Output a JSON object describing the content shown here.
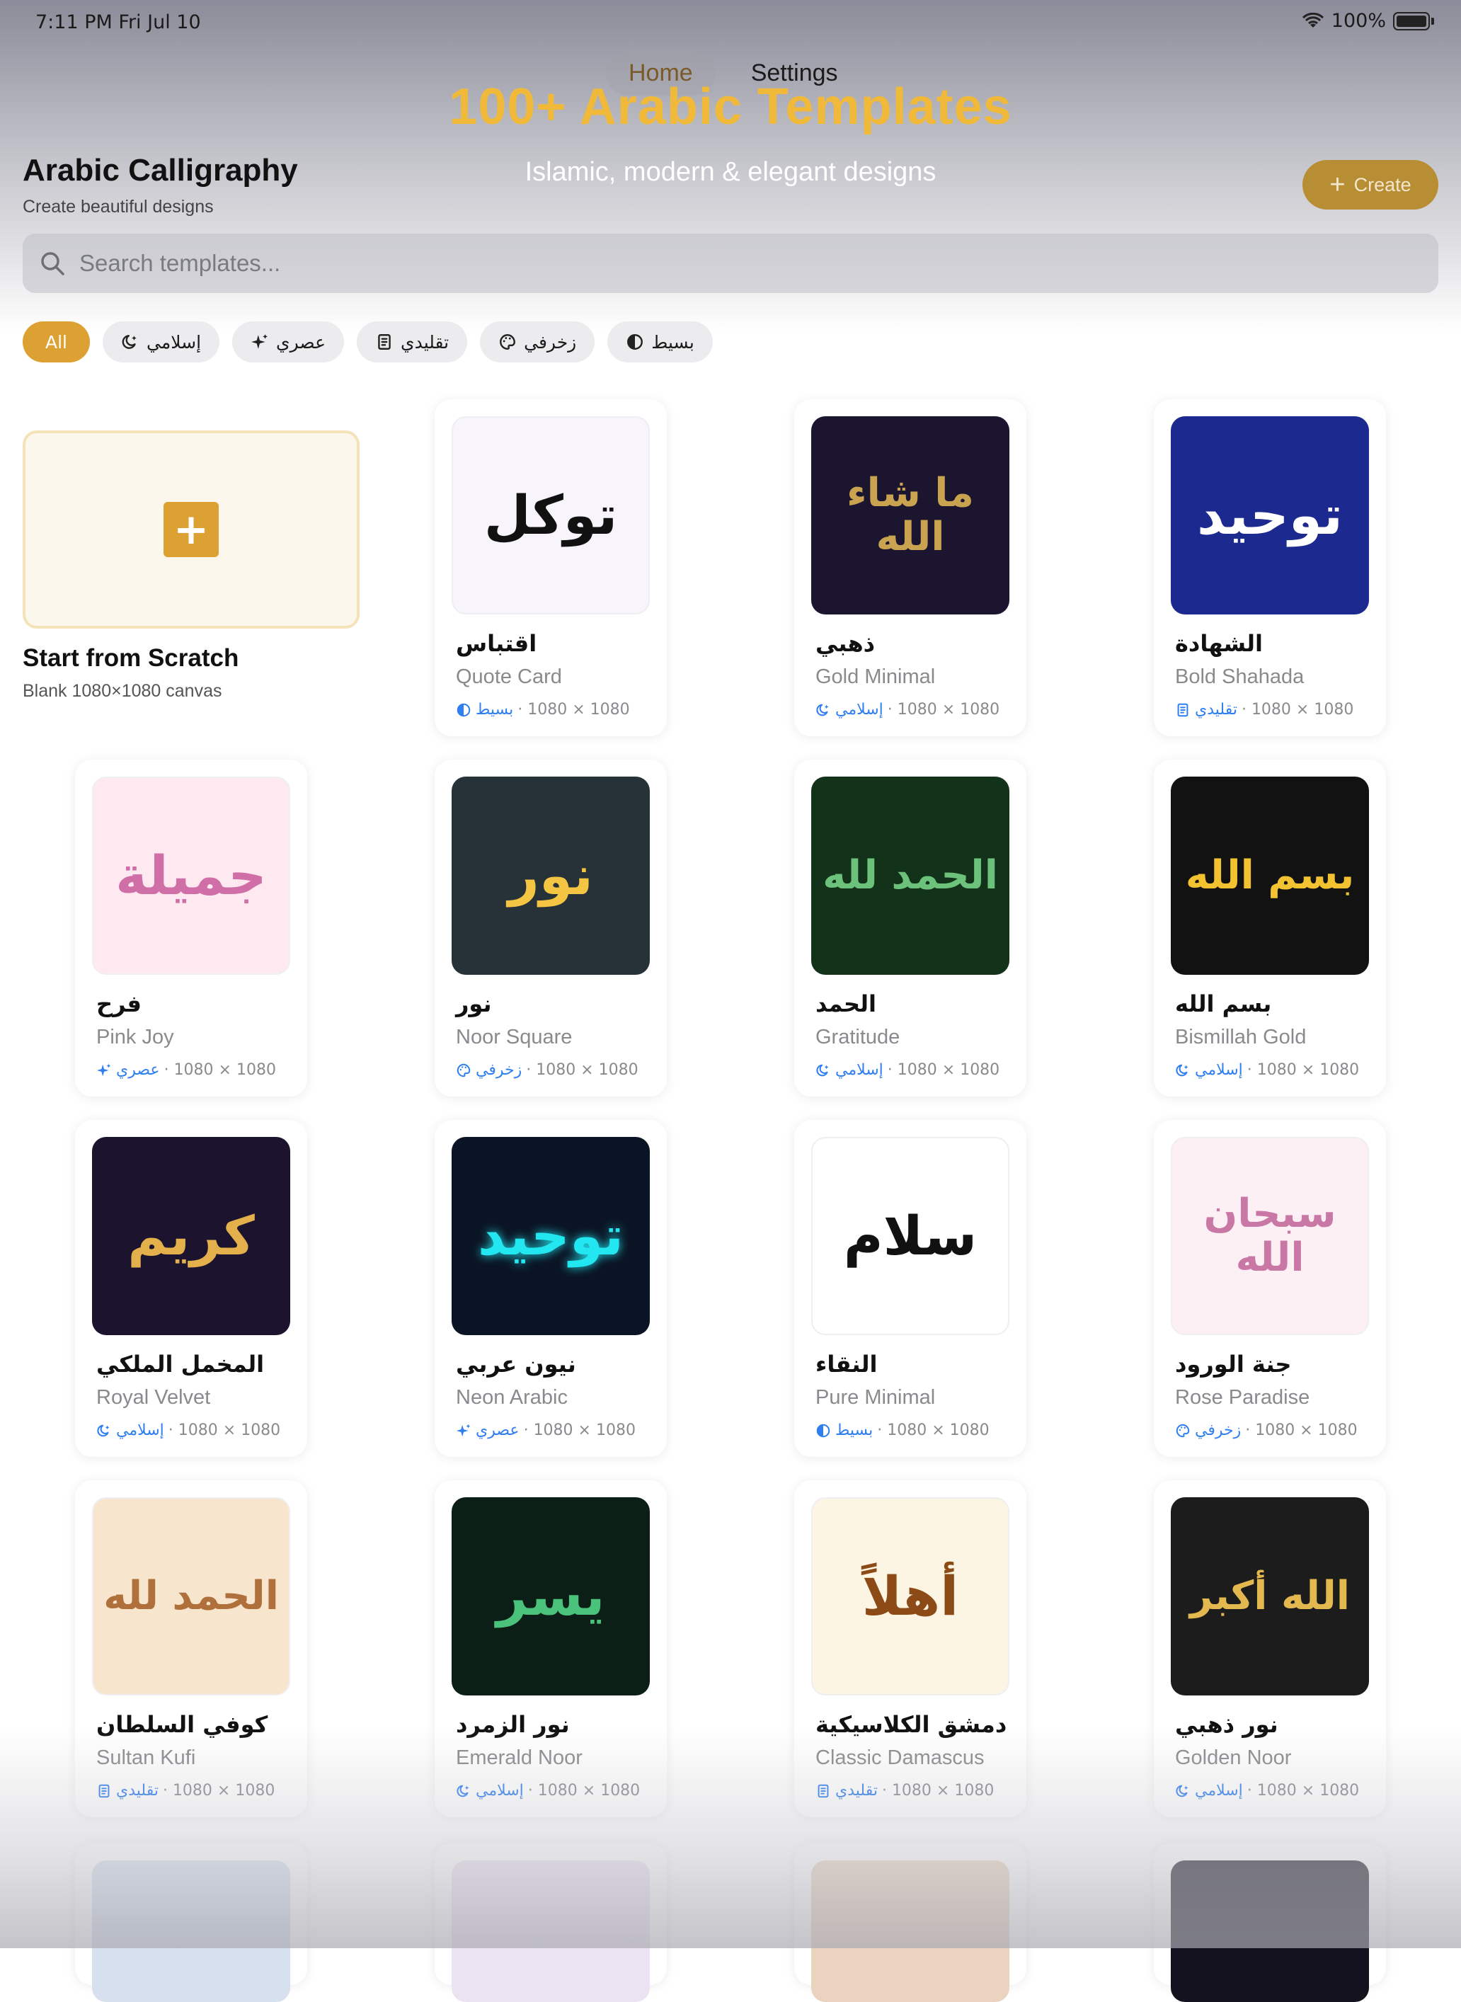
{
  "status": {
    "time": "7:11 PM   Fri Jul 10",
    "battery": "100%"
  },
  "tabs": [
    {
      "label": "Home"
    },
    {
      "label": "Settings"
    }
  ],
  "banner": {
    "title": "100+ Arabic Templates",
    "subtitle": "Islamic, modern & elegant designs"
  },
  "header": {
    "title": "Arabic Calligraphy",
    "subtitle": "Create beautiful designs",
    "create_label": "Create"
  },
  "search": {
    "placeholder": "Search templates..."
  },
  "filters": [
    {
      "label": "All",
      "icon": ""
    },
    {
      "label": "إسلامي",
      "icon": "moon-icon"
    },
    {
      "label": "عصري",
      "icon": "sparkle-icon"
    },
    {
      "label": "تقليدي",
      "icon": "scroll-icon"
    },
    {
      "label": "زخرفي",
      "icon": "palette-icon"
    },
    {
      "label": "بسيط",
      "icon": "contrast-icon"
    }
  ],
  "scratch": {
    "title": "Start from Scratch",
    "subtitle": "Blank 1080×1080 canvas"
  },
  "templates": [
    {
      "ar_title": "اقتباس",
      "name": "Quote Card",
      "category": "بسيط",
      "category_icon": "contrast-icon",
      "size": "· 1080 × 1080",
      "preview_text": "توكل",
      "bg": "#f7f4fc",
      "fg": "#111111"
    },
    {
      "ar_title": "ذهبي",
      "name": "Gold Minimal",
      "category": "إسلامي",
      "category_icon": "moon-icon",
      "size": "· 1080 × 1080",
      "preview_text": "ما شاء الله",
      "bg": "#1b1530",
      "fg": "#caa350"
    },
    {
      "ar_title": "الشهادة",
      "name": "Bold Shahada",
      "category": "تقليدي",
      "category_icon": "scroll-icon",
      "size": "· 1080 × 1080",
      "preview_text": "توحيد",
      "bg": "#1c2a8f",
      "fg": "#ffffff"
    },
    {
      "ar_title": "فرح",
      "name": "Pink Joy",
      "category": "عصري",
      "category_icon": "sparkle-icon",
      "size": "· 1080 × 1080",
      "preview_text": "جميلة",
      "bg": "#fde9ef",
      "fg": "#d06fa7"
    },
    {
      "ar_title": "نور",
      "name": "Noor Square",
      "category": "زخرفي",
      "category_icon": "palette-icon",
      "size": "· 1080 × 1080",
      "preview_text": "نور",
      "bg": "#263238",
      "fg": "#f4c542"
    },
    {
      "ar_title": "الحمد",
      "name": "Gratitude",
      "category": "إسلامي",
      "category_icon": "moon-icon",
      "size": "· 1080 × 1080",
      "preview_text": "الحمد لله",
      "bg": "#12321a",
      "fg": "#6cc27a"
    },
    {
      "ar_title": "بسم الله",
      "name": "Bismillah Gold",
      "category": "إسلامي",
      "category_icon": "moon-icon",
      "size": "· 1080 × 1080",
      "preview_text": "بسم الله",
      "bg": "#121212",
      "fg": "#f2c230"
    },
    {
      "ar_title": "المخمل الملكي",
      "name": "Royal Velvet",
      "category": "إسلامي",
      "category_icon": "moon-icon",
      "size": "· 1080 × 1080",
      "preview_text": "كريم",
      "bg": "#1c132e",
      "fg": "#e3b04b"
    },
    {
      "ar_title": "نيون عربي",
      "name": "Neon Arabic",
      "category": "عصري",
      "category_icon": "sparkle-icon",
      "size": "· 1080 × 1080",
      "preview_text": "توحيد",
      "bg": "#0b1424",
      "fg": "#22e6f0"
    },
    {
      "ar_title": "النقاء",
      "name": "Pure Minimal",
      "category": "بسيط",
      "category_icon": "contrast-icon",
      "size": "· 1080 × 1080",
      "preview_text": "سلام",
      "bg": "#ffffff",
      "fg": "#111111"
    },
    {
      "ar_title": "جنة الورود",
      "name": "Rose Paradise",
      "category": "زخرفي",
      "category_icon": "palette-icon",
      "size": "· 1080 × 1080",
      "preview_text": "سبحان الله",
      "bg": "#fdf0f5",
      "fg": "#c978a6"
    },
    {
      "ar_title": "كوفي السلطان",
      "name": "Sultan Kufi",
      "category": "تقليدي",
      "category_icon": "scroll-icon",
      "size": "· 1080 × 1080",
      "preview_text": "الحمد لله",
      "bg": "#f8e5cd",
      "fg": "#b0703c"
    },
    {
      "ar_title": "نور الزمرد",
      "name": "Emerald Noor",
      "category": "إسلامي",
      "category_icon": "moon-icon",
      "size": "· 1080 × 1080",
      "preview_text": "يسر",
      "bg": "#0c1f16",
      "fg": "#4bc27c"
    },
    {
      "ar_title": "دمشق الكلاسيكية",
      "name": "Classic Damascus",
      "category": "تقليدي",
      "category_icon": "scroll-icon",
      "size": "· 1080 × 1080",
      "preview_text": "أهلاً",
      "bg": "#fdf5e4",
      "fg": "#8b4a16"
    },
    {
      "ar_title": "نور ذهبي",
      "name": "Golden Noor",
      "category": "إسلامي",
      "category_icon": "moon-icon",
      "size": "· 1080 × 1080",
      "preview_text": "الله أكبر",
      "bg": "#1c1c1c",
      "fg": "#e3b84e"
    }
  ],
  "partial_row": [
    {
      "bg": "#d6e0ee"
    },
    {
      "bg": "#ece3f2"
    },
    {
      "bg": "#ead4bf"
    },
    {
      "bg": "#14121e"
    }
  ]
}
